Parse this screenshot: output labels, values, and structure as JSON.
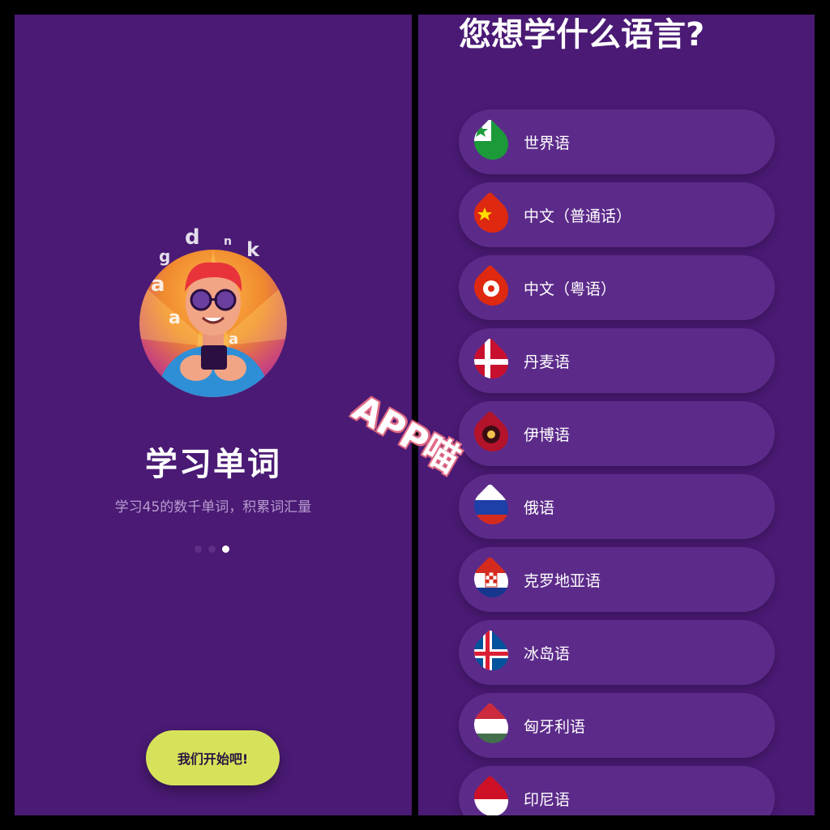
{
  "onboarding": {
    "title": "学习单词",
    "subtitle": "学习45的数千单词，积累词汇量",
    "start_button": "我们开始吧!",
    "page_dots": 3,
    "active_dot": 2,
    "decor_letters": [
      "a",
      "d",
      "n",
      "g",
      "k",
      "a",
      "a"
    ]
  },
  "language_picker": {
    "title": "您想学什么语言?",
    "languages": [
      {
        "label": "世界语",
        "flag": "esperanto-flag-icon"
      },
      {
        "label": "中文（普通话）",
        "flag": "china-flag-icon"
      },
      {
        "label": "中文（粤语）",
        "flag": "hong-kong-flag-icon"
      },
      {
        "label": "丹麦语",
        "flag": "denmark-flag-icon"
      },
      {
        "label": "伊博语",
        "flag": "igbo-flag-icon"
      },
      {
        "label": "俄语",
        "flag": "russia-flag-icon"
      },
      {
        "label": "克罗地亚语",
        "flag": "croatia-flag-icon"
      },
      {
        "label": "冰岛语",
        "flag": "iceland-flag-icon"
      },
      {
        "label": "匈牙利语",
        "flag": "hungary-flag-icon"
      },
      {
        "label": "印尼语",
        "flag": "indonesia-flag-icon"
      }
    ]
  },
  "watermark": "APP喵",
  "colors": {
    "panel_bg": "#4a1a74",
    "row_bg": "#5c2b8a",
    "button_bg": "#d6e35a",
    "subtitle": "#b79cd0"
  }
}
